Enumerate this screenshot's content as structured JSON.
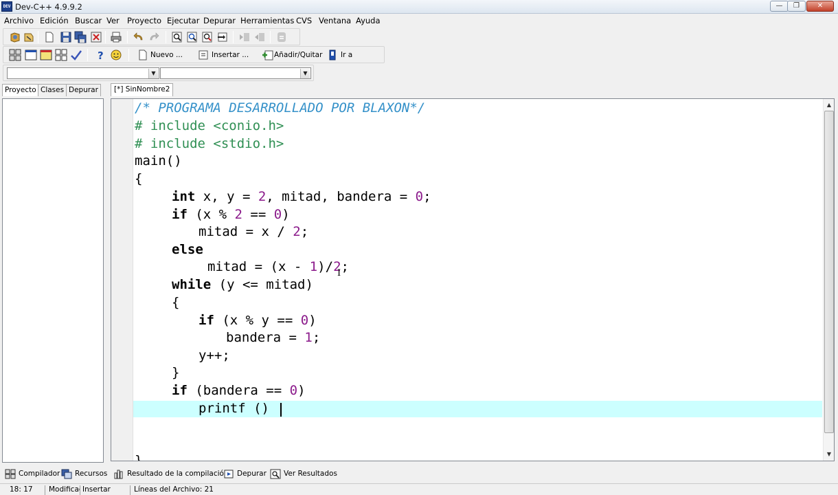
{
  "window": {
    "title": "Dev-C++ 4.9.9.2",
    "icon_text": "DEV",
    "min_icon": "minimize-icon",
    "max_icon": "maximize-icon",
    "close_icon": "close-icon"
  },
  "menu": [
    "Archivo",
    "Edición",
    "Buscar",
    "Ver",
    "Proyecto",
    "Ejecutar",
    "Depurar",
    "Herramientas",
    "CVS",
    "Ventana",
    "Ayuda"
  ],
  "toolbar2": {
    "nuevo": "Nuevo ...",
    "insertar": "Insertar ...",
    "anadir": "Añadir/Quitar",
    "ira": "Ir a"
  },
  "combos": {
    "left_value": "",
    "right_value": ""
  },
  "panel_tabs": [
    "Proyecto",
    "Clases",
    "Depurar"
  ],
  "editor_tab": "[*] SinNombre2",
  "code": [
    "/* PROGRAMA DESARROLLADO POR BLAXON*/",
    "# include <conio.h>",
    "# include <stdio.h>",
    "main()",
    "{",
    "int x, y = 2, mitad, bandera = 0;",
    "if (x % 2 == 0)",
    "mitad = x / 2;",
    "else",
    "mitad = (x - 1)/2;",
    "while (y <= mitad)",
    "{",
    "if (x % y == 0)",
    "bandera = 1;",
    "y++;",
    "}",
    "if (bandera == 0)",
    "printf ()",
    "}"
  ],
  "bottom_tabs": [
    "Compilador",
    "Recursos",
    "Resultado de la compilación",
    "Depurar",
    "Ver Resultados"
  ],
  "status": {
    "position": "18: 17",
    "modified": "Modificad",
    "mode": "Insertar",
    "lines": "Líneas del Archivo: 21"
  },
  "colors": {
    "comment": "#3591c9",
    "preprocessor": "#2f8f53",
    "number": "#8b1a8b",
    "current_line": "#ccffff"
  }
}
